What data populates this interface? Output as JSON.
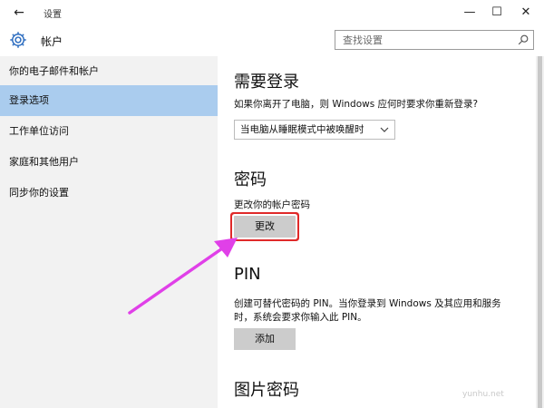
{
  "window": {
    "title": "设置",
    "back_icon": "back-arrow-icon",
    "controls": {
      "minimize": "—",
      "maximize": "☐",
      "close": "✕"
    }
  },
  "header": {
    "title": "帐户",
    "icon": "gear-icon",
    "search": {
      "placeholder": "查找设置",
      "icon": "search-icon"
    }
  },
  "sidebar": {
    "items": [
      {
        "label": "你的电子邮件和帐户"
      },
      {
        "label": "登录选项",
        "selected": true
      },
      {
        "label": "工作单位访问"
      },
      {
        "label": "家庭和其他用户"
      },
      {
        "label": "同步你的设置"
      }
    ],
    "selected_color": "#aaccee"
  },
  "content": {
    "require_signin": {
      "heading": "需要登录",
      "description": "如果你离开了电脑，则 Windows 应何时要求你重新登录?",
      "dropdown_value": "当电脑从睡眠模式中被唤醒时"
    },
    "password": {
      "heading": "密码",
      "description": "更改你的帐户密码",
      "button": "更改"
    },
    "pin": {
      "heading": "PIN",
      "description_line1": "创建可替代密码的 PIN。当你登录到 Windows 及其应用和服务",
      "description_line2": "时，系统会要求你输入此 PIN。",
      "button": "添加"
    },
    "picture_password": {
      "heading": "图片密码"
    }
  },
  "annotations": {
    "highlight_color": "#e02a2a",
    "arrow_color": "#e040e8"
  },
  "watermark": "yunhu.net"
}
